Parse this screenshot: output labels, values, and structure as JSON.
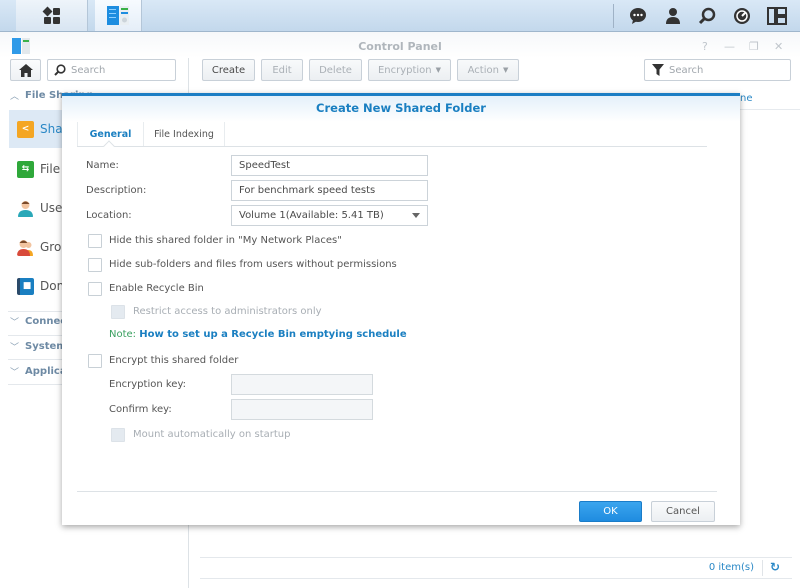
{
  "taskbar": {
    "main_menu_icon": "grid-icon",
    "active_app_icon": "control-panel-icon",
    "right_icons": [
      "chat-icon",
      "user-icon",
      "search-icon",
      "dashboard-icon",
      "widgets-icon"
    ]
  },
  "window": {
    "title": "Control Panel",
    "controls": {
      "help": "?",
      "minimize": "—",
      "restore": "❐",
      "close": "✕"
    }
  },
  "toolbar": {
    "left_search_placeholder": "Search",
    "buttons": [
      {
        "label": "Create",
        "enabled": true
      },
      {
        "label": "Edit",
        "enabled": false
      },
      {
        "label": "Delete",
        "enabled": false
      },
      {
        "label": "Encryption",
        "enabled": false,
        "dropdown": true
      },
      {
        "label": "Action",
        "enabled": false,
        "dropdown": true
      }
    ],
    "right_search_placeholder": "Search"
  },
  "sidebar": {
    "groups": [
      {
        "label": "File Sharing",
        "expanded": true
      },
      {
        "label": "Connectivity",
        "expanded": false
      },
      {
        "label": "System",
        "expanded": false
      },
      {
        "label": "Applications",
        "expanded": false
      }
    ],
    "items": [
      {
        "label": "Shared Folder",
        "icon": "shared-folder-icon",
        "color": "#f4a623",
        "active": true
      },
      {
        "label": "File Services",
        "icon": "file-services-icon",
        "color": "#2fa83a",
        "active": false
      },
      {
        "label": "User",
        "icon": "user-icon",
        "color": "#2aa8b8",
        "active": false
      },
      {
        "label": "Group",
        "icon": "group-icon",
        "color": "#d84a3a",
        "active": false
      },
      {
        "label": "Domain/LDAP",
        "icon": "domain-icon",
        "color": "#1a7fc1",
        "active": false
      }
    ]
  },
  "grid": {
    "column_fragment": "ne",
    "item_count": "0 item(s)"
  },
  "dialog": {
    "title": "Create New Shared Folder",
    "tabs": [
      {
        "label": "General",
        "active": true
      },
      {
        "label": "File Indexing",
        "active": false
      }
    ],
    "fields": {
      "name_label": "Name:",
      "name_value": "SpeedTest",
      "description_label": "Description:",
      "description_value": "For benchmark speed tests",
      "location_label": "Location:",
      "location_value": "Volume 1(Available: 5.41 TB)"
    },
    "checkboxes": {
      "hide_network_places": {
        "label": "Hide this shared folder in \"My Network Places\"",
        "checked": false
      },
      "hide_subfolders": {
        "label": "Hide sub-folders and files from users without permissions",
        "checked": false
      },
      "enable_recycle_bin": {
        "label": "Enable Recycle Bin",
        "checked": false
      },
      "restrict_admin": {
        "label": "Restrict access to administrators only",
        "checked": false,
        "disabled": true
      },
      "encrypt": {
        "label": "Encrypt this shared folder",
        "checked": false
      },
      "mount_auto": {
        "label": "Mount automatically on startup",
        "checked": false,
        "disabled": true
      }
    },
    "note": {
      "prefix": "Note: ",
      "link": "How to set up a Recycle Bin emptying schedule"
    },
    "encryption": {
      "key_label": "Encryption key:",
      "key_value": "",
      "confirm_label": "Confirm key:",
      "confirm_value": ""
    },
    "buttons": {
      "ok": "OK",
      "cancel": "Cancel"
    }
  },
  "colors": {
    "accent": "#1a7fc1",
    "ok_button": "#2a96e6",
    "note_green": "#3aa060"
  }
}
